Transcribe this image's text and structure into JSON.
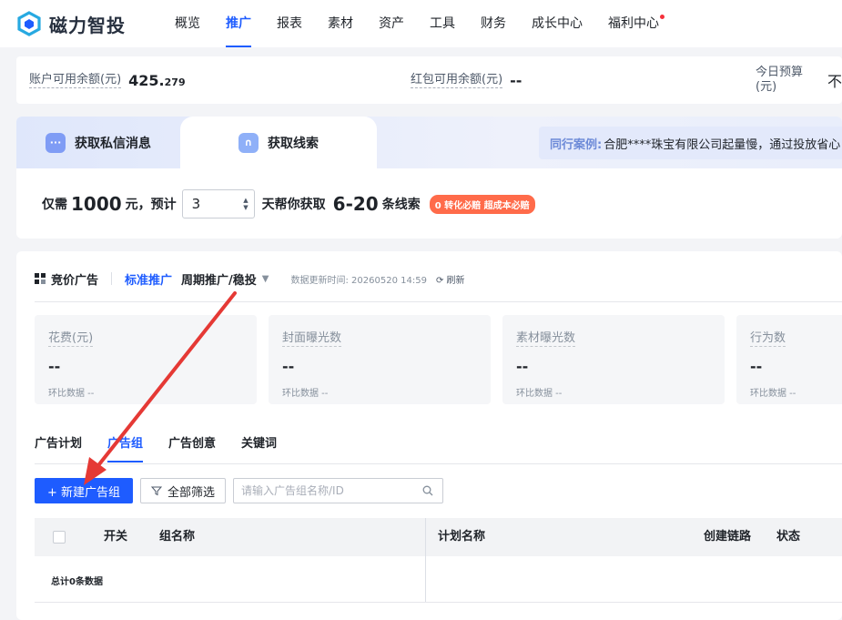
{
  "brand": {
    "name": "磁力智投",
    "accent": "#1e5cff"
  },
  "nav": {
    "items": [
      {
        "label": "概览",
        "active": false
      },
      {
        "label": "推广",
        "active": true
      },
      {
        "label": "报表",
        "active": false
      },
      {
        "label": "素材",
        "active": false
      },
      {
        "label": "资产",
        "active": false
      },
      {
        "label": "工具",
        "active": false
      },
      {
        "label": "财务",
        "active": false
      },
      {
        "label": "成长中心",
        "active": false
      },
      {
        "label": "福利中心",
        "active": false,
        "dot": true
      }
    ]
  },
  "balance": {
    "account_label": "账户可用余额(元)",
    "account_int": "425.",
    "account_dec": "279",
    "red_label": "红包可用余额(元)",
    "red_value": "--",
    "budget_label": "今日预算(元)",
    "budget_value": "不"
  },
  "acquire": {
    "tab_private": "获取私信消息",
    "tab_leads": "获取线索",
    "case_title": "同行案例:",
    "case_text": "合肥****珠宝有限公司起量慢，通过投放省心",
    "only": "仅需",
    "amount": "1000",
    "yuan_est": "元，预计",
    "days_value": "3",
    "days_text": "天帮你获取",
    "range": "6-20",
    "leads_unit": "条线索",
    "badge": "0 转化必赔 超成本必赔"
  },
  "ads": {
    "title": "竞价广告",
    "standard": "标准推广",
    "period": "周期推广/稳投",
    "updated": "数据更新时间: 20260520 14:59",
    "refresh": "刷新",
    "metrics": [
      {
        "label": "花费(元)",
        "value": "--",
        "compare": "环比数据 --"
      },
      {
        "label": "封面曝光数",
        "value": "--",
        "compare": "环比数据 --"
      },
      {
        "label": "素材曝光数",
        "value": "--",
        "compare": "环比数据 --"
      },
      {
        "label": "行为数",
        "value": "--",
        "compare": "环比数据 --"
      }
    ],
    "tabs": [
      {
        "label": "广告计划",
        "active": false
      },
      {
        "label": "广告组",
        "active": true
      },
      {
        "label": "广告创意",
        "active": false
      },
      {
        "label": "关键词",
        "active": false
      }
    ],
    "new_button": "+ 新建广告组",
    "filter_button": "全部筛选",
    "search_placeholder": "请输入广告组名称/ID",
    "columns": {
      "switch": "开关",
      "group_name": "组名称",
      "plan_name": "计划名称",
      "link": "创建链路",
      "status": "状态"
    },
    "total": "总计0条数据"
  }
}
